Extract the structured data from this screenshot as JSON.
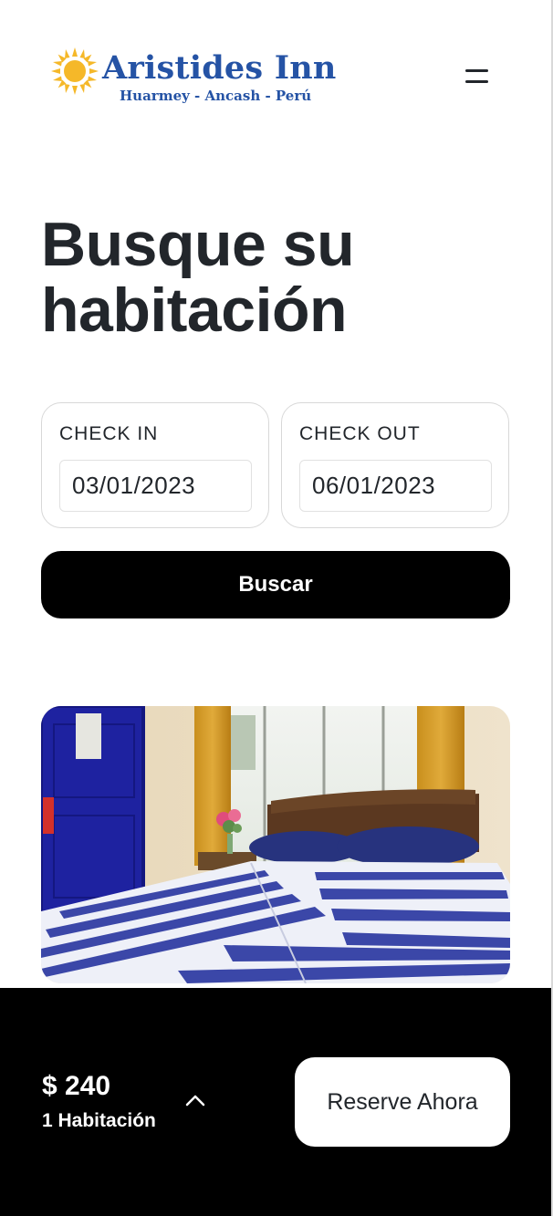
{
  "header": {
    "logo_title": "Aristides Inn",
    "logo_subtitle": "Huarmey - Ancash - Perú",
    "logo_icon": "sun-icon",
    "menu_icon": "hamburger-menu-icon",
    "brand_color": "#2553a5",
    "sun_color": "#f5b829"
  },
  "search": {
    "title": "Busque su habitación",
    "check_in": {
      "label": "CHECK IN",
      "value": "03/01/2023"
    },
    "check_out": {
      "label": "CHECK OUT",
      "value": "06/01/2023"
    },
    "button_label": "Buscar"
  },
  "room": {
    "image": "room-photo"
  },
  "booking_bar": {
    "price": "$ 240",
    "rooms": "1 Habitación",
    "expand_icon": "chevron-up-icon",
    "button_label": "Reserve Ahora"
  }
}
